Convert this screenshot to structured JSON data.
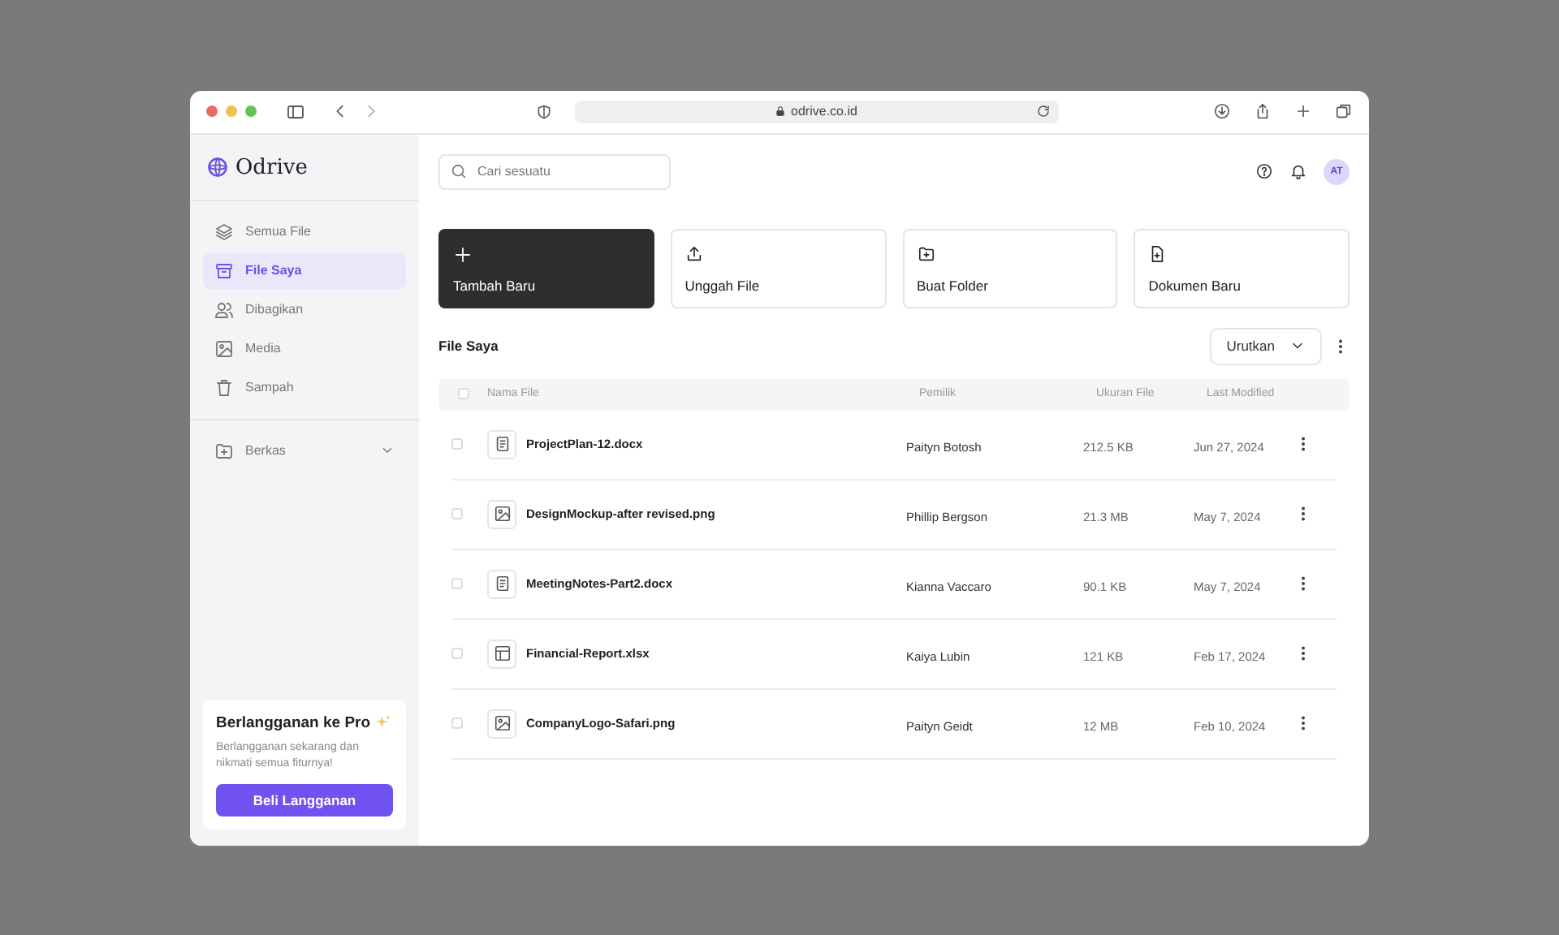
{
  "browser": {
    "url": "odrive.co.id"
  },
  "sidebar": {
    "logo": "Odrive",
    "items": [
      {
        "label": "Semua File",
        "kind": "layers",
        "selected": false
      },
      {
        "label": "File Saya",
        "kind": "archive",
        "selected": true
      },
      {
        "label": "Dibagikan",
        "kind": "users",
        "selected": false
      },
      {
        "label": "Media",
        "kind": "image",
        "selected": false
      },
      {
        "label": "Sampah",
        "kind": "trash",
        "selected": false
      }
    ],
    "folders": [
      {
        "label": "Berkas",
        "kind": "folder",
        "expanded": false
      }
    ],
    "promo": {
      "title": "Berlangganan ke Pro",
      "text": "Berlangganan sekarang dan nikmati semua fiturnya!",
      "button": "Beli Langganan"
    }
  },
  "search": {
    "placeholder": "Cari sesuatu"
  },
  "avatar": "AT",
  "actions": [
    {
      "label": "Tambah Baru",
      "kind": "plus",
      "highlighted": true
    },
    {
      "label": "Unggah File",
      "kind": "upload",
      "highlighted": false
    },
    {
      "label": "Buat Folder",
      "kind": "folder",
      "highlighted": false
    },
    {
      "label": "Dokumen Baru",
      "kind": "doc",
      "highlighted": false
    }
  ],
  "section_title": "File Saya",
  "sort_button": "Urutkan",
  "table": {
    "columns": [
      "Nama File",
      "Pemilik",
      "Ukuran File",
      "Last Modified"
    ],
    "header_checked": false,
    "rows": [
      {
        "name": "ProjectPlan-12.docx",
        "kind": "doc",
        "owner": "Paityn Botosh",
        "size": "212.5 KB",
        "modified": "Jun 27, 2024",
        "checked": false
      },
      {
        "name": "DesignMockup-after revised.png",
        "kind": "image",
        "owner": "Phillip Bergson",
        "size": "21.3 MB",
        "modified": "May 7, 2024",
        "checked": false
      },
      {
        "name": "MeetingNotes-Part2.docx",
        "kind": "doc",
        "owner": "Kianna Vaccaro",
        "size": "90.1 KB",
        "modified": "May 7, 2024",
        "checked": false
      },
      {
        "name": "Financial-Report.xlsx",
        "kind": "sheet",
        "owner": "Kaiya Lubin",
        "size": "121 KB",
        "modified": "Feb 17, 2024",
        "checked": false
      },
      {
        "name": "CompanyLogo-Safari.png",
        "kind": "image",
        "owner": "Paityn Geidt",
        "size": "12 MB",
        "modified": "Feb 10, 2024",
        "checked": false
      }
    ]
  }
}
